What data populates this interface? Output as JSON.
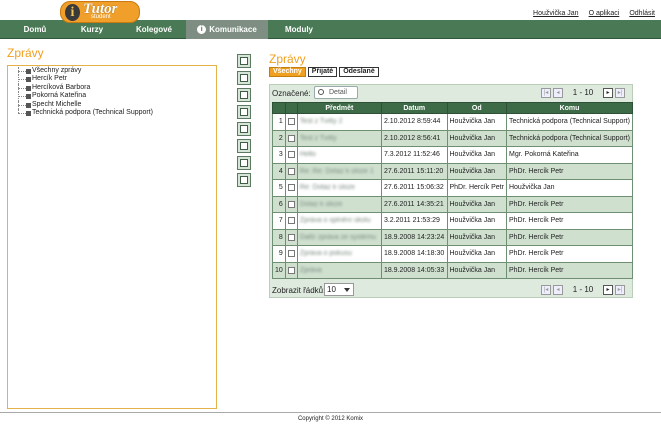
{
  "app": {
    "logo_i": "i",
    "logo_name": "Tutor",
    "logo_sub": "student"
  },
  "toplinks": [
    "Houžvička Jan",
    "O aplikaci",
    "Odhlásit"
  ],
  "nav": {
    "items": [
      {
        "label": "Domů"
      },
      {
        "label": "Kurzy"
      },
      {
        "label": "Kolegové"
      },
      {
        "label": "Komunikace",
        "active": true
      },
      {
        "label": "Moduly"
      }
    ]
  },
  "left": {
    "title": "Zprávy",
    "tree": [
      "Všechny zprávy",
      "Hercík Petr",
      "Hercíková Barbora",
      "Pokorná Kateřina",
      "Specht Michelle",
      "Technická podpora (Technical Support)"
    ]
  },
  "right": {
    "title": "Zprávy",
    "filters": [
      {
        "label": "Všechny",
        "active": true
      },
      {
        "label": "Přijaté"
      },
      {
        "label": "Odeslané"
      }
    ],
    "marked_label": "Označené:",
    "detail_label": "Detail",
    "page_info": "1 - 10",
    "rows_label": "Zobrazit řádků:",
    "rows_value": "10",
    "columns": [
      "Předmět",
      "Datum",
      "Od",
      "Komu"
    ],
    "rows": [
      {
        "n": "1",
        "subject": "Test z Tvitty 2",
        "date": "2.10.2012 8:59:44",
        "from": "Houžvička Jan",
        "to": "Technická podpora (Technical Support)"
      },
      {
        "n": "2",
        "subject": "Test z Tvitty",
        "date": "2.10.2012 8:56:41",
        "from": "Houžvička Jan",
        "to": "Technická podpora (Technical Support)"
      },
      {
        "n": "3",
        "subject": "Hello",
        "date": "7.3.2012 11:52:46",
        "from": "Houžvička Jan",
        "to": "Mgr. Pokorná Kateřina"
      },
      {
        "n": "4",
        "subject": "Re: Re: Dotaz k úloze 1",
        "date": "27.6.2011 15:11:20",
        "from": "Houžvička Jan",
        "to": "PhDr. Hercík Petr"
      },
      {
        "n": "5",
        "subject": "Re: Dotaz k úloze",
        "date": "27.6.2011 15:06:32",
        "from": "PhDr. Hercík Petr",
        "to": "Houžvička Jan"
      },
      {
        "n": "6",
        "subject": "Dotaz k úloze",
        "date": "27.6.2011 14:35:21",
        "from": "Houžvička Jan",
        "to": "PhDr. Hercík Petr"
      },
      {
        "n": "7",
        "subject": "Zpráva o splnění úkolu",
        "date": "3.2.2011 21:53:29",
        "from": "Houžvička Jan",
        "to": "PhDr. Hercík Petr"
      },
      {
        "n": "8",
        "subject": "Další zpráva ze systému",
        "date": "18.9.2008 14:23:24",
        "from": "Houžvička Jan",
        "to": "PhDr. Hercík Petr"
      },
      {
        "n": "9",
        "subject": "Zpráva o pokusu",
        "date": "18.9.2008 14:18:30",
        "from": "Houžvička Jan",
        "to": "PhDr. Hercík Petr"
      },
      {
        "n": "10",
        "subject": "Zpráva",
        "date": "18.9.2008 14:05:33",
        "from": "Houžvička Jan",
        "to": "PhDr. Hercík Petr"
      }
    ]
  },
  "footer": "Copyright © 2012 Komix"
}
